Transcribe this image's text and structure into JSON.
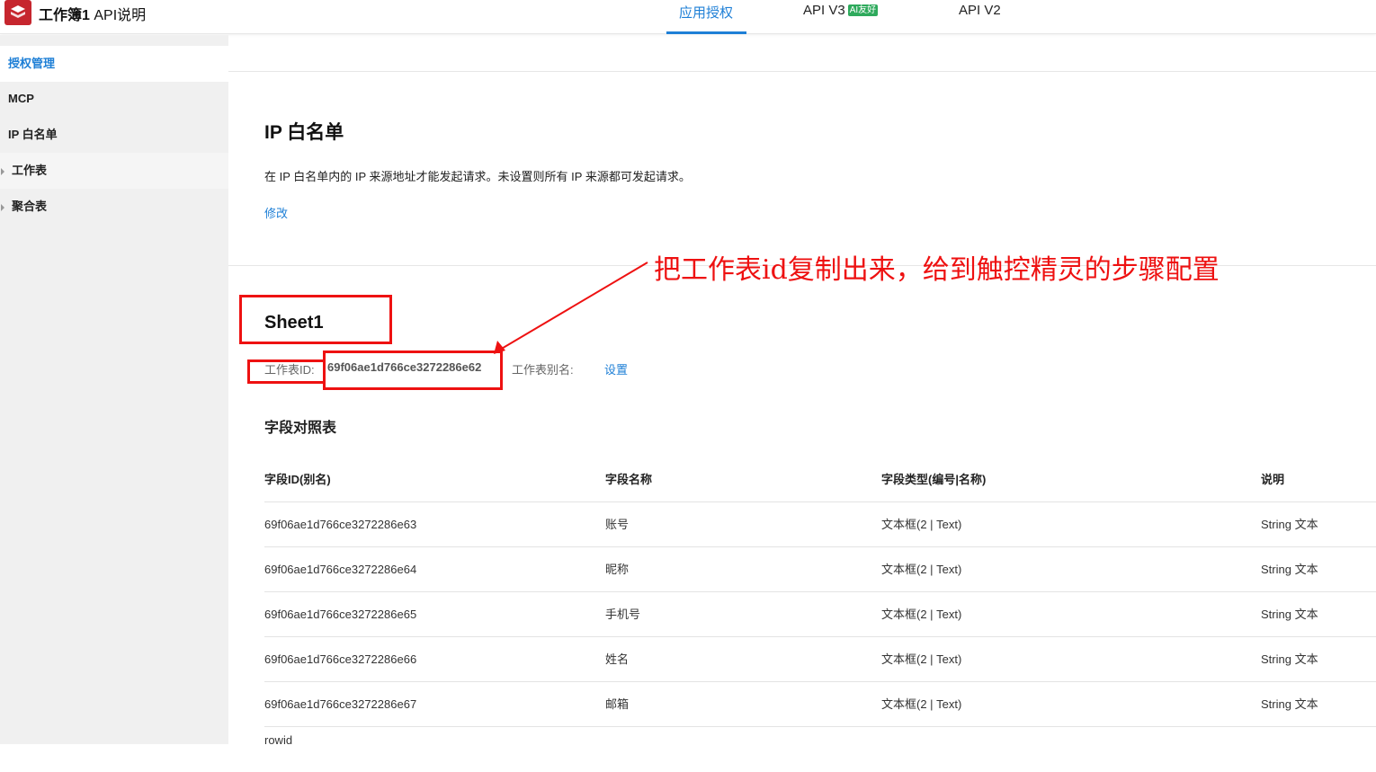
{
  "header": {
    "app_title_bold": "工作簿1",
    "app_title_rest": " API说明",
    "tabs": [
      {
        "label": "应用授权",
        "active": true
      },
      {
        "label": "API V3",
        "badge": "AI友好"
      },
      {
        "label": "API V2"
      }
    ]
  },
  "sidebar": {
    "items": [
      {
        "label": "授权管理",
        "active": true
      },
      {
        "label": "MCP"
      },
      {
        "label": "IP 白名单"
      },
      {
        "label": "工作表",
        "collapsible": true
      },
      {
        "label": "聚合表",
        "collapsible": true
      }
    ]
  },
  "ip_section": {
    "title": "IP 白名单",
    "description": "在 IP 白名单内的 IP 来源地址才能发起请求。未设置则所有 IP 来源都可发起请求。",
    "edit_link": "修改"
  },
  "sheet": {
    "title": "Sheet1",
    "id_label": "工作表ID:",
    "id_value": "69f06ae1d766ce3272286e62",
    "alias_label": "工作表别名:",
    "alias_link": "设置",
    "fields_title": "字段对照表",
    "columns": [
      "字段ID(别名)",
      "字段名称",
      "字段类型(编号|名称)",
      "说明"
    ],
    "rows": [
      [
        "69f06ae1d766ce3272286e63",
        "账号",
        "文本框(2 | Text)",
        "String 文本"
      ],
      [
        "69f06ae1d766ce3272286e64",
        "昵称",
        "文本框(2 | Text)",
        "String 文本"
      ],
      [
        "69f06ae1d766ce3272286e65",
        "手机号",
        "文本框(2 | Text)",
        "String 文本"
      ],
      [
        "69f06ae1d766ce3272286e66",
        "姓名",
        "文本框(2 | Text)",
        "String 文本"
      ],
      [
        "69f06ae1d766ce3272286e67",
        "邮箱",
        "文本框(2 | Text)",
        "String 文本"
      ],
      [
        "rowid",
        "",
        "",
        ""
      ]
    ]
  },
  "annotation": {
    "text": "把工作表id复制出来，给到触控精灵的步骤配置",
    "color": "#ee1111"
  },
  "colors": {
    "accent": "#1e7fd6",
    "badge": "#2eaa5c",
    "logo": "#c6262e"
  }
}
